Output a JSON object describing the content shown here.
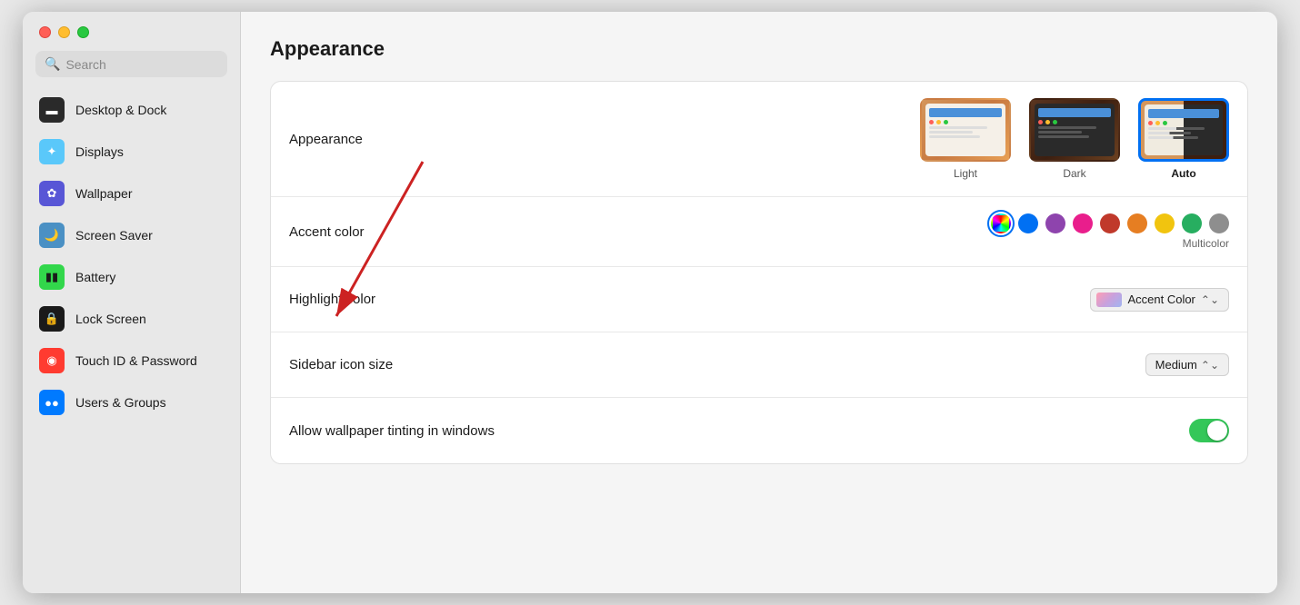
{
  "window": {
    "title": "Appearance"
  },
  "sidebar": {
    "search_placeholder": "Search",
    "items": [
      {
        "id": "desktop-dock",
        "label": "Desktop & Dock",
        "icon": "🖥",
        "icon_class": "icon-desktop"
      },
      {
        "id": "displays",
        "label": "Displays",
        "icon": "☀",
        "icon_class": "icon-displays"
      },
      {
        "id": "wallpaper",
        "label": "Wallpaper",
        "icon": "✿",
        "icon_class": "icon-wallpaper"
      },
      {
        "id": "screen-saver",
        "label": "Screen Saver",
        "icon": "🌙",
        "icon_class": "icon-screensaver"
      },
      {
        "id": "battery",
        "label": "Battery",
        "icon": "🔋",
        "icon_class": "icon-battery"
      },
      {
        "id": "lock-screen",
        "label": "Lock Screen",
        "icon": "🔒",
        "icon_class": "icon-lockscreen"
      },
      {
        "id": "touch-id",
        "label": "Touch ID & Password",
        "icon": "◉",
        "icon_class": "icon-touchid"
      },
      {
        "id": "users-groups",
        "label": "Users & Groups",
        "icon": "👥",
        "icon_class": "icon-users"
      }
    ]
  },
  "main": {
    "page_title": "Appearance",
    "sections": {
      "appearance": {
        "label": "Appearance",
        "options": [
          {
            "id": "light",
            "label": "Light",
            "selected": false
          },
          {
            "id": "dark",
            "label": "Dark",
            "selected": false
          },
          {
            "id": "auto",
            "label": "Auto",
            "selected": true
          }
        ]
      },
      "accent_color": {
        "label": "Accent color",
        "sublabel": "Multicolor",
        "colors": [
          {
            "id": "multicolor",
            "color": "conic-gradient(red, yellow, lime, aqua, blue, magenta, red)",
            "is_conic": true,
            "selected": true
          },
          {
            "id": "blue",
            "color": "#0070f3",
            "selected": false
          },
          {
            "id": "purple",
            "color": "#8e44ad",
            "selected": false
          },
          {
            "id": "pink",
            "color": "#e91e8c",
            "selected": false
          },
          {
            "id": "red",
            "color": "#c0392b",
            "selected": false
          },
          {
            "id": "orange",
            "color": "#e67e22",
            "selected": false
          },
          {
            "id": "yellow",
            "color": "#f1c40f",
            "selected": false
          },
          {
            "id": "green",
            "color": "#27ae60",
            "selected": false
          },
          {
            "id": "graphite",
            "color": "#8e8e8e",
            "selected": false
          }
        ]
      },
      "highlight_color": {
        "label": "Highlight color",
        "value": "Accent Color"
      },
      "sidebar_icon_size": {
        "label": "Sidebar icon size",
        "value": "Medium"
      },
      "wallpaper_tinting": {
        "label": "Allow wallpaper tinting in windows",
        "enabled": true
      }
    }
  },
  "arrow": {
    "color": "#cc2222"
  }
}
